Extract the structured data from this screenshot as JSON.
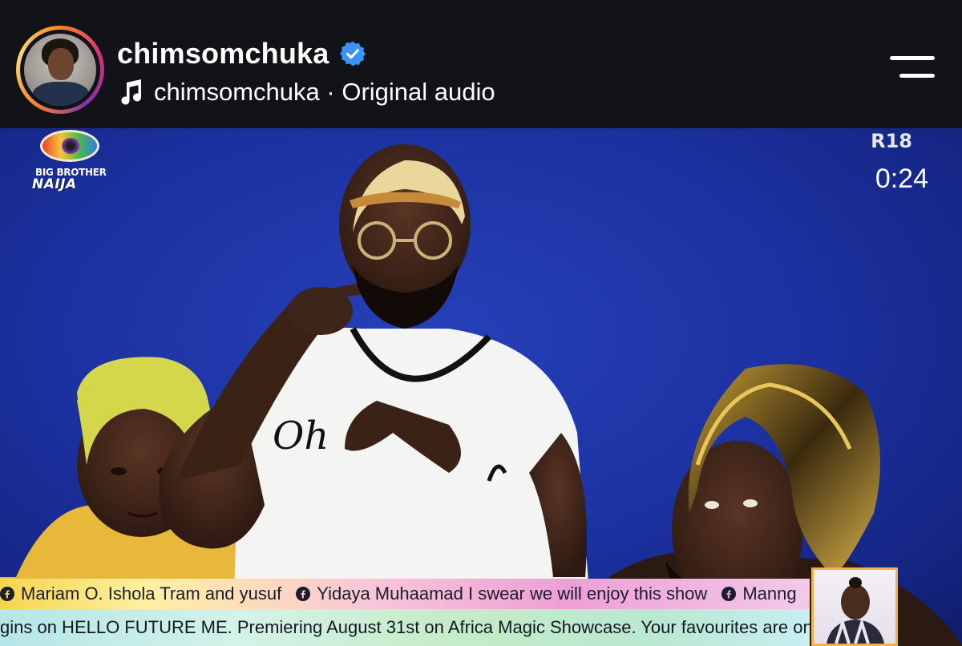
{
  "header": {
    "username": "chimsomchuka",
    "verified": true,
    "audio": {
      "artist": "chimsomchuka",
      "separator": "·",
      "label": "Original audio"
    }
  },
  "video": {
    "logo": {
      "line1": "BIG BROTHER",
      "line2": "NAIJA"
    },
    "rating": "R18",
    "timer": "0:24",
    "shirt_text": "Oh",
    "ticker_top": [
      {
        "icon": "facebook-icon",
        "text": "Mariam O. Ishola Tram and yusuf"
      },
      {
        "icon": "facebook-icon",
        "text": "Yidaya Muhaamad I swear we will enjoy this show"
      },
      {
        "icon": "facebook-icon",
        "text": "Manng"
      }
    ],
    "ticker_bottom": "gins on HELLO FUTURE ME. Premiering August 31st on Africa Magic Showcase.  Your favourites are on DStv. Fro"
  },
  "colors": {
    "header_bg": "#121318",
    "verified_badge": "#3b94f5",
    "video_bg": "#1d33a4",
    "ticker_top": "#f6d54d",
    "ticker_bottom": "#b6e6e8"
  }
}
